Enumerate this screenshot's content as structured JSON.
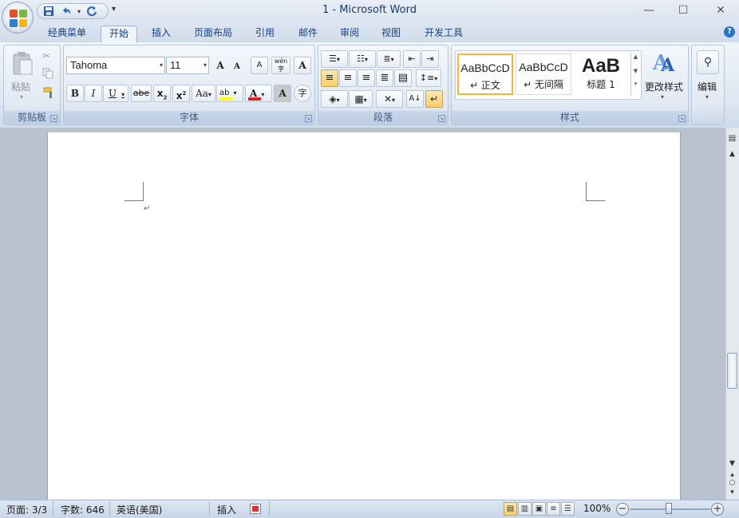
{
  "window": {
    "title": "1 - Microsoft Word",
    "minimize": "—",
    "maximize": "☐",
    "close": "✕"
  },
  "qat": {
    "save_icon": "save-icon",
    "undo_icon": "undo-icon",
    "redo_icon": "redo-icon",
    "customize": "▾"
  },
  "tabs": [
    "经典菜单",
    "开始",
    "插入",
    "页面布局",
    "引用",
    "邮件",
    "审阅",
    "视图",
    "开发工具"
  ],
  "active_tab": "开始",
  "ribbon": {
    "clipboard": {
      "label": "剪贴板",
      "paste": "粘贴",
      "paste_caret": "▾"
    },
    "font": {
      "label": "字体",
      "font_name": "Tahoma",
      "font_size": "11",
      "grow": "A",
      "shrink": "A",
      "clear": "A",
      "phonetic": "wén",
      "border_char": "A",
      "bold": "B",
      "italic": "I",
      "underline": "U",
      "strike": "abe",
      "subscript": "x",
      "superscript": "x",
      "change_case": "Aa",
      "highlight": "ab",
      "font_color": "A",
      "shading": "A",
      "enclose": "字"
    },
    "paragraph": {
      "label": "段落"
    },
    "styles": {
      "label": "样式",
      "items": [
        {
          "preview": "AaBbCcD",
          "name": "↵ 正文"
        },
        {
          "preview": "AaBbCcD",
          "name": "↵ 无间隔"
        },
        {
          "preview": "AaB",
          "name": "标题 1"
        }
      ],
      "change_styles": "更改样式",
      "change_caret": "▾"
    },
    "editing": {
      "label": "编辑",
      "caret": "▾"
    }
  },
  "document": {
    "paragraph_mark": "↵"
  },
  "statusbar": {
    "page": "页面: 3/3",
    "words": "字数: 646",
    "language": "英语(美国)",
    "mode": "插入",
    "zoom": "100%",
    "zoom_minus": "−",
    "zoom_plus": "+"
  },
  "colors": {
    "accent": "#15428b",
    "highlight_bar": "#ffff00",
    "font_color_bar": "#e02020"
  }
}
